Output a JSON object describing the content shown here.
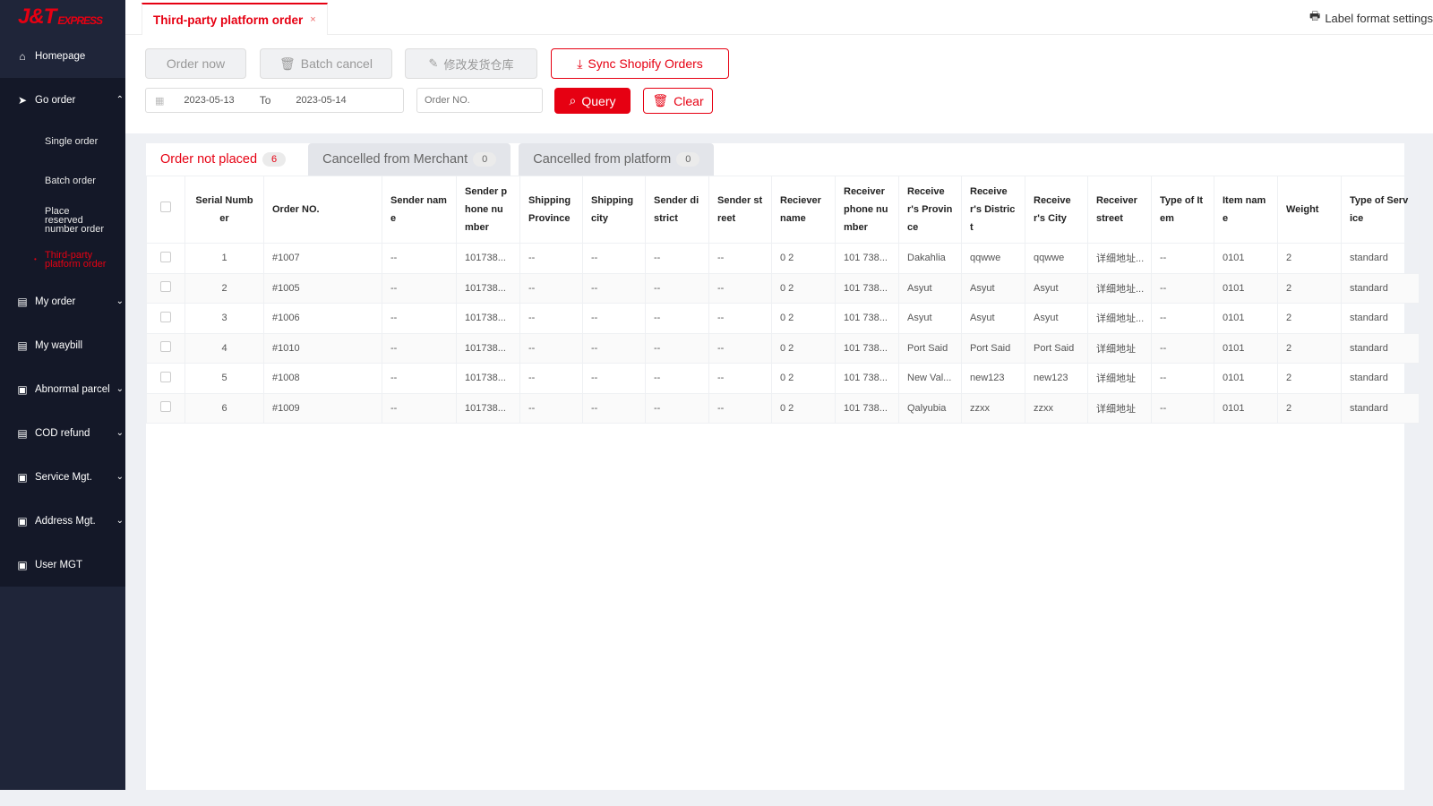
{
  "brand": {
    "logo": "J&T",
    "logo_sub": "EXPRESS",
    "accent": "#e60012"
  },
  "sidebar": {
    "items": [
      {
        "label": "Homepage",
        "icon": "home-icon",
        "glyph": "⌂"
      },
      {
        "label": "Go order",
        "icon": "cursor-icon",
        "glyph": "➤",
        "chev": "⌃",
        "sub": [
          "Single order",
          "Batch order",
          "Place reserved number order",
          "Third-party platform order"
        ]
      },
      {
        "label": "My order",
        "icon": "order-icon",
        "glyph": "▤",
        "chev": "⌄"
      },
      {
        "label": "My waybill",
        "icon": "waybill-icon",
        "glyph": "▤"
      },
      {
        "label": "Abnormal parcel",
        "icon": "parcel-icon",
        "glyph": "▣",
        "chev": "⌄"
      },
      {
        "label": "COD refund",
        "icon": "refund-icon",
        "glyph": "▤",
        "chev": "⌄"
      },
      {
        "label": "Service Mgt.",
        "icon": "service-icon",
        "glyph": "▣",
        "chev": "⌄"
      },
      {
        "label": "Address Mgt.",
        "icon": "address-icon",
        "glyph": "▣",
        "chev": "⌄"
      },
      {
        "label": "User MGT",
        "icon": "user-icon",
        "glyph": "▣"
      }
    ]
  },
  "top": {
    "tab": "Third-party platform order",
    "close": "×",
    "label_format": "Label format settings"
  },
  "toolbar": {
    "order_now": "Order now",
    "batch_cancel": "Batch cancel",
    "modify_warehouse": "修改发货仓库",
    "sync": "Sync Shopify Orders",
    "date_from": "2023-05-13",
    "date_to_label": "To",
    "date_to": "2023-05-14",
    "order_placeholder": "Order NO.",
    "query": "Query",
    "clear": "Clear"
  },
  "tabs": [
    {
      "label": "Order not placed",
      "count": "6"
    },
    {
      "label": "Cancelled from Merchant",
      "count": "0"
    },
    {
      "label": "Cancelled from platform",
      "count": "0"
    }
  ],
  "table": {
    "columns": [
      "Serial Number",
      "Order NO.",
      "Sender name",
      "Sender phone number",
      "Shipping Province",
      "Shipping city",
      "Sender district",
      "Sender street",
      "Reciever name",
      "Receiver phone number",
      "Receiver's Province",
      "Receiver's District",
      "Receiver's City",
      "Receiver street",
      "Type of Item",
      "Item name",
      "Weight",
      "Type of Service"
    ],
    "rows": [
      [
        "1",
        "#1007",
        "--",
        "101738...",
        "--",
        "--",
        "--",
        "--",
        "0 2",
        "101 738...",
        "Dakahlia",
        "qqwwe",
        "qqwwe",
        "详细地址...",
        "--",
        "0101",
        "2",
        "standard"
      ],
      [
        "2",
        "#1005",
        "--",
        "101738...",
        "--",
        "--",
        "--",
        "--",
        "0 2",
        "101 738...",
        "Asyut",
        "Asyut",
        "Asyut",
        "详细地址...",
        "--",
        "0101",
        "2",
        "standard"
      ],
      [
        "3",
        "#1006",
        "--",
        "101738...",
        "--",
        "--",
        "--",
        "--",
        "0 2",
        "101 738...",
        "Asyut",
        "Asyut",
        "Asyut",
        "详细地址...",
        "--",
        "0101",
        "2",
        "standard"
      ],
      [
        "4",
        "#1010",
        "--",
        "101738...",
        "--",
        "--",
        "--",
        "--",
        "0 2",
        "101 738...",
        "Port Said",
        "Port Said",
        "Port Said",
        "详细地址",
        "--",
        "0101",
        "2",
        "standard"
      ],
      [
        "5",
        "#1008",
        "--",
        "101738...",
        "--",
        "--",
        "--",
        "--",
        "0 2",
        "101 738...",
        "New Val...",
        "new123",
        "new123",
        "详细地址",
        "--",
        "0101",
        "2",
        "standard"
      ],
      [
        "6",
        "#1009",
        "--",
        "101738...",
        "--",
        "--",
        "--",
        "--",
        "0 2",
        "101 738...",
        "Qalyubia",
        "zzxx",
        "zzxx",
        "详细地址",
        "--",
        "0101",
        "2",
        "standard"
      ]
    ]
  }
}
